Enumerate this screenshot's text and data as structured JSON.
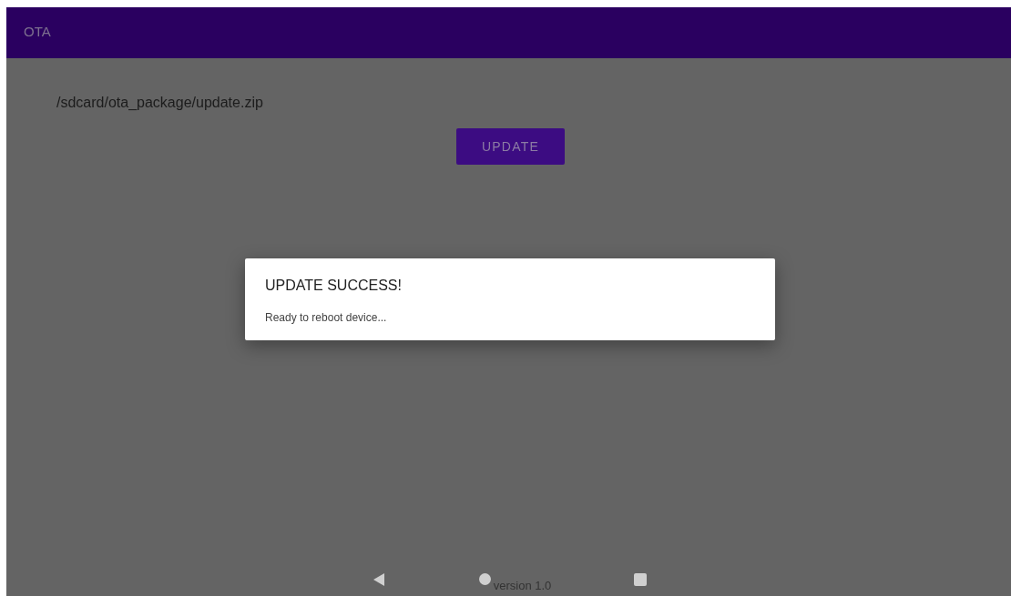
{
  "app_bar": {
    "title": "OTA"
  },
  "content": {
    "file_path": "/sdcard/ota_package/update.zip",
    "button": "UPDATE",
    "version": "version 1.0"
  },
  "dialog": {
    "title": "UPDATE SUCCESS!",
    "message": "Ready to reboot device..."
  }
}
